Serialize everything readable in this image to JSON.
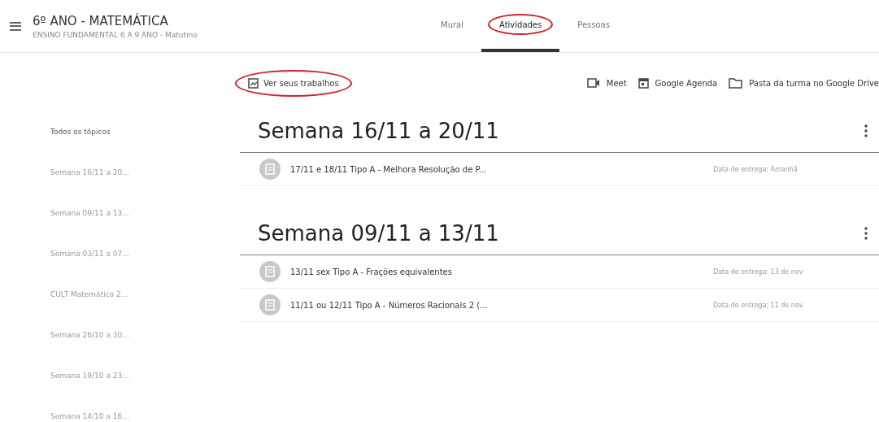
{
  "header": {
    "title": "6º ANO - MATEMÁTICA",
    "subtitle": "ENSINO FUNDAMENTAL 6 A 9 ANO - Matutino"
  },
  "tabs": [
    {
      "label": "Mural",
      "selected": false,
      "circled": false
    },
    {
      "label": "Atividades",
      "selected": true,
      "circled": true
    },
    {
      "label": "Pessoas",
      "selected": false,
      "circled": false
    }
  ],
  "toolbar": {
    "your_work": {
      "label": "Ver seus trabalhos",
      "circled": true
    },
    "links": [
      {
        "kind": "video",
        "label": "Meet"
      },
      {
        "kind": "calendar",
        "label": "Google Agenda"
      },
      {
        "kind": "folder",
        "label": "Pasta da turma no Google Drive"
      }
    ]
  },
  "sidebar": {
    "items": [
      {
        "label": "Todos os tópicos",
        "selected": true
      },
      {
        "label": "Semana 16/11 a 20...",
        "selected": false
      },
      {
        "label": "Semana 09/11 a 13...",
        "selected": false
      },
      {
        "label": "Semana 03/11 a 07...",
        "selected": false
      },
      {
        "label": "CULT Matemática 2...",
        "selected": false
      },
      {
        "label": "Semana 26/10 a 30...",
        "selected": false
      },
      {
        "label": "Semana 19/10 a 23...",
        "selected": false
      },
      {
        "label": "Semana 14/10 a 16...",
        "selected": false
      }
    ]
  },
  "topics": [
    {
      "title": "Semana 16/11 a 20/11",
      "assignments": [
        {
          "title": "17/11 e 18/11 Tipo A - Melhora Resolução de P...",
          "due": "Data de entrega: Amanhã"
        }
      ]
    },
    {
      "title": "Semana 09/11 a 13/11",
      "assignments": [
        {
          "title": "13/11 sex Tipo A - Frações equivalentes",
          "due": "Data de entrega: 13 de nov"
        },
        {
          "title": "11/11 ou 12/11 Tipo A - Números Racionais 2 (...",
          "due": "Data de entrega: 11 de nov"
        }
      ]
    }
  ]
}
